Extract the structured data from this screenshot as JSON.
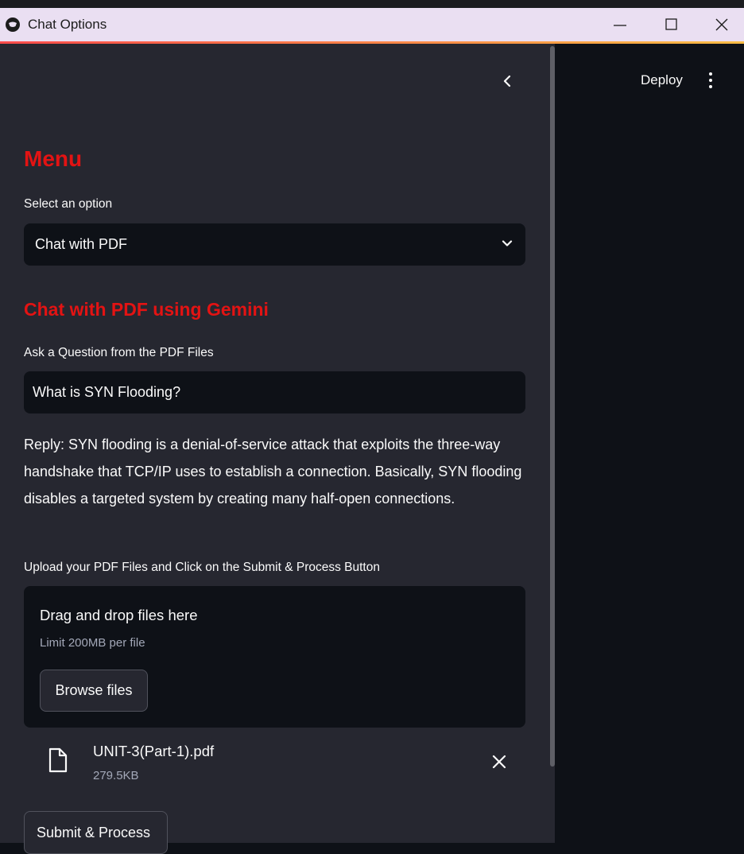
{
  "window": {
    "title": "Chat Options",
    "controls": [
      "minimize-icon",
      "maximize-icon",
      "close-icon"
    ]
  },
  "header": {
    "deploy_label": "Deploy",
    "icons": [
      "chevron-left-icon",
      "kebab-menu-icon"
    ]
  },
  "sidebar": {
    "menu_heading": "Menu",
    "select_label": "Select an option",
    "select_value": "Chat with PDF",
    "section_heading": "Chat with PDF using Gemini",
    "question_label": "Ask a Question from the PDF Files",
    "question_value": "What is SYN Flooding?",
    "reply_text": "Reply: SYN flooding is a denial-of-service attack that exploits the three-way handshake that TCP/IP uses to establish a connection. Basically, SYN flooding disables a targeted system by creating many half-open connections.",
    "upload_label": "Upload your PDF Files and Click on the Submit & Process Button",
    "dropzone": {
      "title": "Drag and drop files here",
      "limit": "Limit 200MB per file",
      "browse_label": "Browse files"
    },
    "uploaded_file": {
      "name": "UNIT-3(Part-1).pdf",
      "size": "279.5KB"
    },
    "submit_label": "Submit & Process"
  },
  "colors": {
    "heading_red": "#e31313",
    "sidebar_bg": "#262730",
    "main_bg": "#0e1117",
    "titlebar_bg": "#eadff2"
  }
}
